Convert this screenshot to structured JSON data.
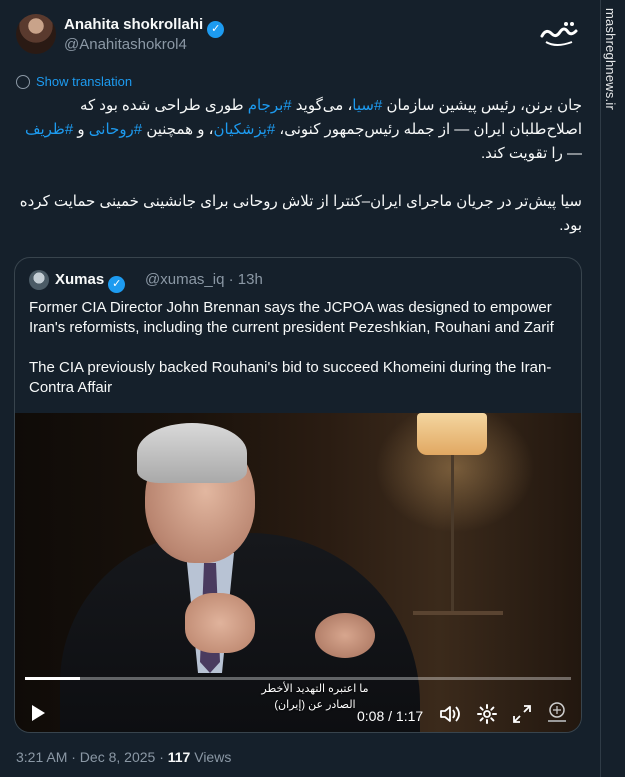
{
  "header": {
    "display_name": "Anahita shokrollahi",
    "handle": "@Anahitashokrol4",
    "verified_icon": "verified-badge-icon"
  },
  "watermark": "mashreghnews.ir",
  "show_translation": "Show translation",
  "tweet": {
    "para1": [
      {
        "text": "جان برنن، رئیس پیشین سازمان ",
        "tag": false
      },
      {
        "text": "#سیا",
        "tag": true
      },
      {
        "text": "، می‌گوید ",
        "tag": false
      },
      {
        "text": "#برجام",
        "tag": true
      },
      {
        "text": " طوری طراحی شده بود که اصلاح‌طلبان ایران — از جمله رئیس‌جمهور کنونی، ",
        "tag": false
      },
      {
        "text": "#پزشکیان",
        "tag": true
      },
      {
        "text": "، و همچنین ",
        "tag": false
      },
      {
        "text": "#روحانی",
        "tag": true
      },
      {
        "text": " و ",
        "tag": false
      },
      {
        "text": "#ظریف",
        "tag": true
      },
      {
        "text": " — را تقویت کند.",
        "tag": false
      }
    ],
    "para2": "سیا پیش‌تر در جریان ماجرای ایران–کنترا از تلاش روحانی برای جانشینی خمینی حمایت کرده بود."
  },
  "quote": {
    "name": "Xumas",
    "handle_time": "@xumas_iq · 13h",
    "text1": "Former CIA Director John Brennan says the JCPOA was designed to empower Iran's reformists, including the current president Pezeshkian, Rouhani and Zarif",
    "text2": "The CIA previously backed Rouhani's bid to succeed Khomeini during the Iran-Contra Affair",
    "video": {
      "subtitle_line1": "ما اعتبره التهديد الأخطر",
      "subtitle_line2": "الصادر عن (إيران)",
      "time": "0:08 / 1:17",
      "progress": 0.1
    }
  },
  "meta": {
    "time": "3:21 AM · Dec 8, 2025 · ",
    "views_count": "117",
    "views_label": " Views"
  }
}
